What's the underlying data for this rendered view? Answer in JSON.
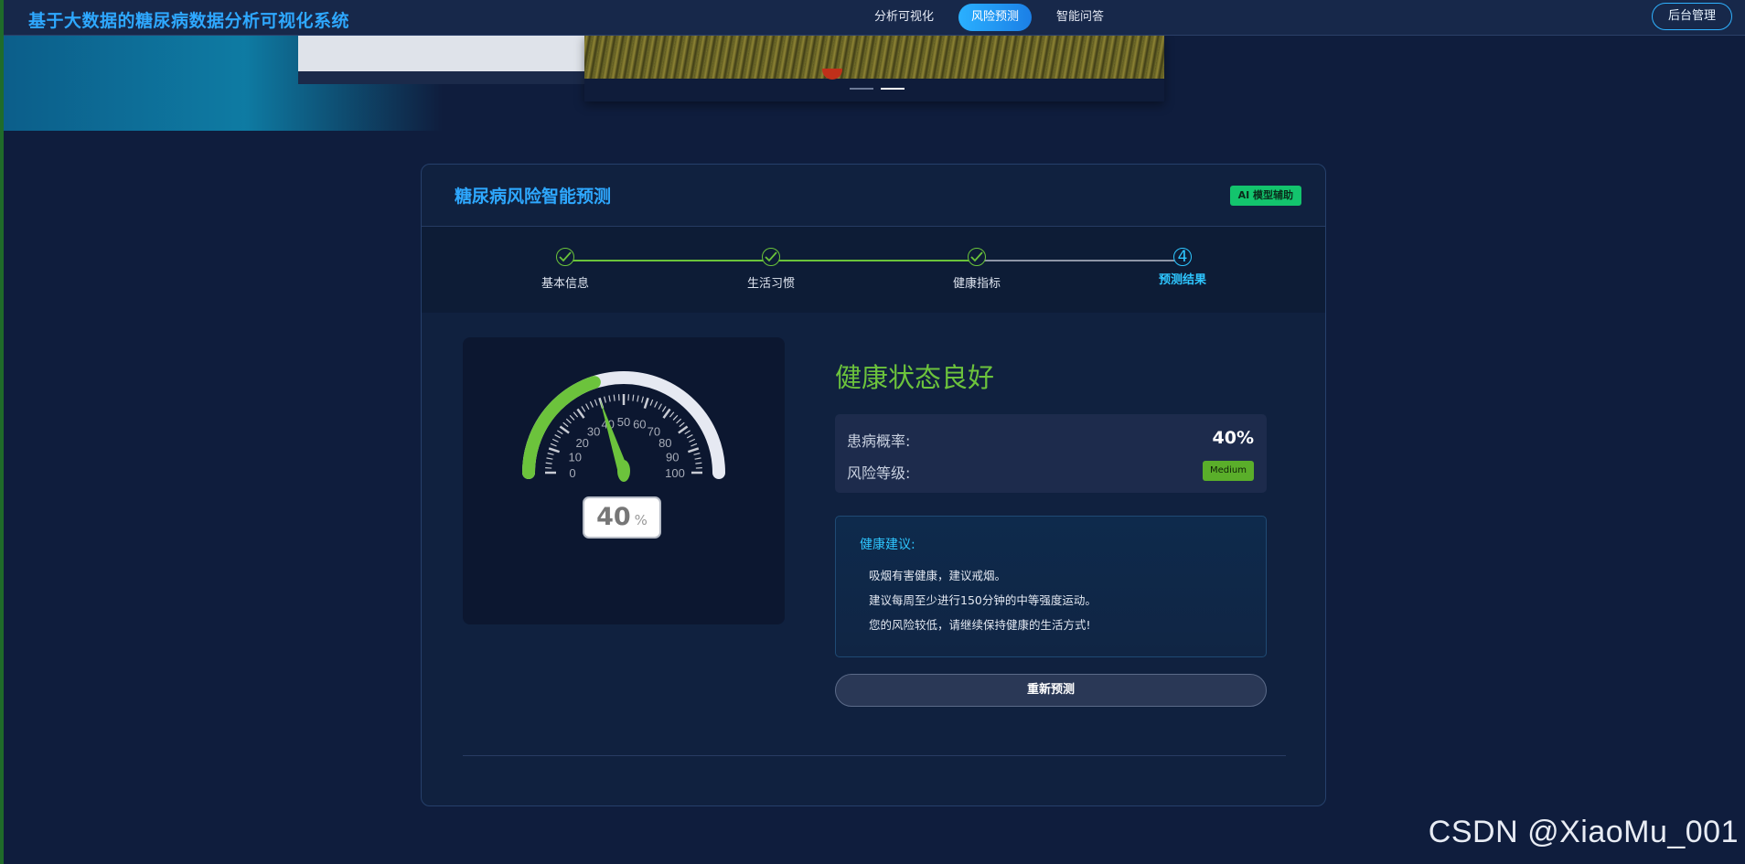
{
  "header": {
    "app_title": "基于大数据的糖尿病数据分析可视化系统",
    "nav": [
      "分析可视化",
      "风险预测",
      "智能问答"
    ],
    "active_nav": "风险预测",
    "admin_button": "后台管理",
    "accent_color": "#2ea8ff"
  },
  "carousel": {
    "slide_count": 2,
    "active_slide": 2
  },
  "panel": {
    "title": "糖尿病风险智能预测",
    "badge": "AI 模型辅助"
  },
  "steps": [
    {
      "label": "基本信息",
      "status": "done",
      "icon": "check-icon"
    },
    {
      "label": "生活习惯",
      "status": "done",
      "icon": "check-icon"
    },
    {
      "label": "健康指标",
      "status": "done",
      "icon": "check-icon"
    },
    {
      "label": "预测结果",
      "status": "current",
      "number": "4"
    }
  ],
  "gauge": {
    "value": 40,
    "unit": "%",
    "min": 0,
    "max": 100,
    "tick_labels": [
      "0",
      "10",
      "20",
      "30",
      "40",
      "50",
      "60",
      "70",
      "80",
      "90",
      "100"
    ],
    "fill_color": "#6cc33c",
    "track_color": "#e6e9f2"
  },
  "result": {
    "status_text": "健康状态良好",
    "probability_label": "患病概率:",
    "probability_value": "40%",
    "risk_label": "风险等级:",
    "risk_value": "Medium",
    "advice_title": "健康建议:",
    "advice": [
      "吸烟有害健康，建议戒烟。",
      "建议每周至少进行150分钟的中等强度运动。",
      "您的风险较低，请继续保持健康的生活方式!"
    ],
    "repredict_button": "重新预测"
  },
  "watermark": "CSDN @XiaoMu_001"
}
